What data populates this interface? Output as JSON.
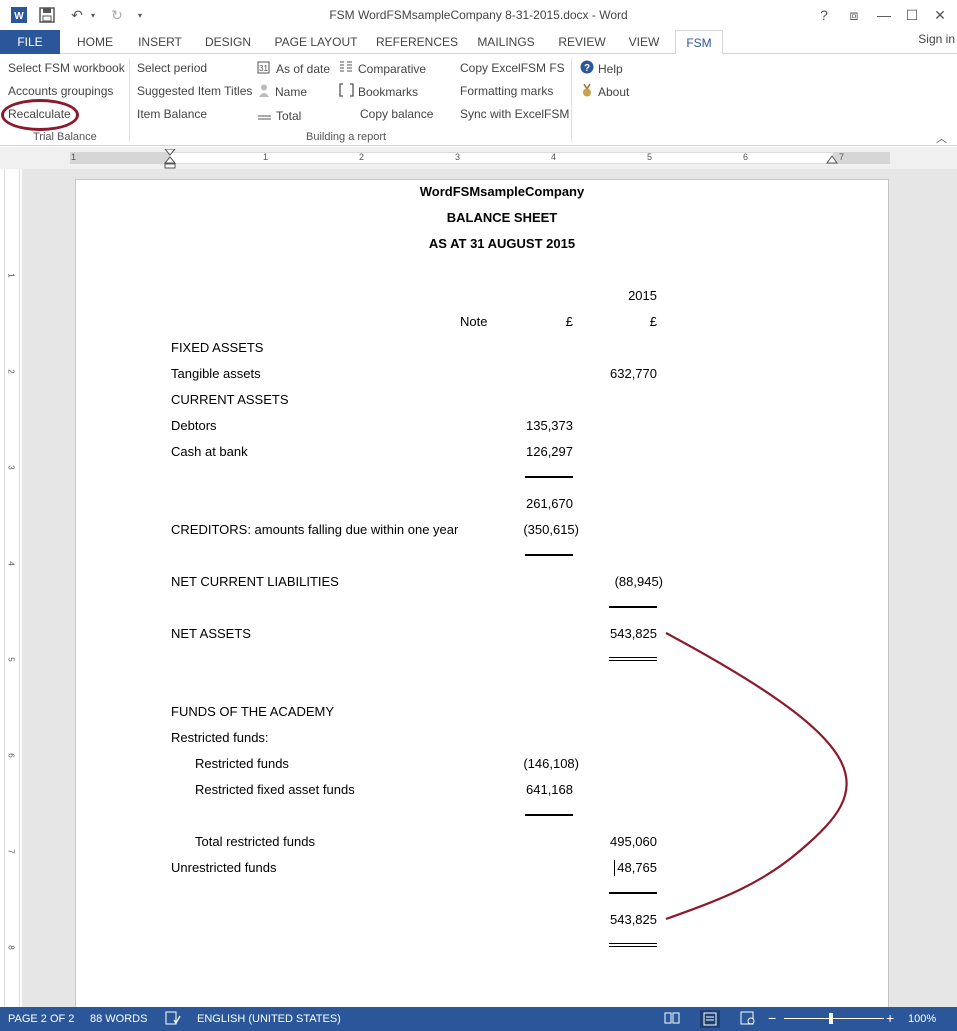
{
  "window": {
    "title": "FSM WordFSMsampleCompany 8-31-2015.docx - Word",
    "qat": {
      "word_icon": "word-app-icon",
      "save_icon": "save-icon",
      "undo_icon": "undo-icon",
      "redo_icon": "redo-icon",
      "customize_icon": "customize-qat-icon"
    },
    "controls": {
      "help": "?",
      "restore_ribbon": "⧈",
      "minimize": "—",
      "maximize": "☐",
      "close": "✕"
    }
  },
  "tabs": [
    {
      "label": "FILE"
    },
    {
      "label": "HOME"
    },
    {
      "label": "INSERT"
    },
    {
      "label": "DESIGN"
    },
    {
      "label": "PAGE LAYOUT"
    },
    {
      "label": "REFERENCES"
    },
    {
      "label": "MAILINGS"
    },
    {
      "label": "REVIEW"
    },
    {
      "label": "VIEW"
    },
    {
      "label": "FSM"
    }
  ],
  "active_tab": "FSM",
  "signin": "Sign in",
  "ribbon": {
    "trial_balance": {
      "label": "Trial Balance",
      "select_fsm_workbook": "Select FSM workbook",
      "accounts_groupings": "Accounts groupings",
      "recalculate": "Recalculate"
    },
    "building_report": {
      "label": "Building a report",
      "select_period": "Select period",
      "suggested_item_titles": "Suggested Item Titles",
      "item_balance": "Item Balance",
      "as_of_date": "As of date",
      "name": "Name",
      "total": "Total",
      "comparative": "Comparative",
      "bookmarks": "Bookmarks",
      "copy_balance": "Copy balance",
      "copy_excelfsm_fs": "Copy ExcelFSM FS",
      "formatting_marks": "Formatting marks",
      "sync_with_excelfsm": "Sync with ExcelFSM"
    },
    "help": {
      "help": "Help",
      "about": "About"
    }
  },
  "ruler": {
    "h_numbers": [
      "1",
      "1",
      "2",
      "3",
      "4",
      "5",
      "6",
      "7"
    ],
    "v_numbers": [
      "1",
      "2",
      "3",
      "4",
      "5",
      "6",
      "7",
      "8"
    ]
  },
  "document": {
    "company": "WordFSMsampleCompany",
    "heading": "BALANCE SHEET",
    "date_line": "AS AT 31 AUGUST 2015",
    "year": "2015",
    "note_header": "Note",
    "currency_col1": "£",
    "currency_col2": "£",
    "fixed_assets": "FIXED ASSETS",
    "tangible_assets": "Tangible assets",
    "tangible_assets_value": "632,770",
    "current_assets": "CURRENT ASSETS",
    "debtors": "Debtors",
    "debtors_value": "135,373",
    "cash_at_bank": "Cash at bank",
    "cash_at_bank_value": "126,297",
    "current_assets_total": "261,670",
    "creditors": "CREDITORS: amounts falling due within one year",
    "creditors_value": "(350,615)",
    "net_current_liabilities": "NET CURRENT LIABILITIES",
    "net_current_liabilities_value": "(88,945)",
    "net_assets": "NET ASSETS",
    "net_assets_value": "543,825",
    "funds_of_academy": "FUNDS OF THE ACADEMY",
    "restricted_funds_heading": "Restricted funds:",
    "restricted_funds": "Restricted funds",
    "restricted_funds_value": "(146,108)",
    "restricted_fixed_asset_funds": "Restricted fixed asset funds",
    "restricted_fixed_asset_funds_value": "641,168",
    "total_restricted_funds": "Total restricted funds",
    "total_restricted_funds_value": "495,060",
    "unrestricted_funds": "Unrestricted funds",
    "unrestricted_funds_value": "48,765",
    "total_funds_value": "543,825"
  },
  "statusbar": {
    "page": "PAGE 2 OF 2",
    "words": "88 WORDS",
    "language": "ENGLISH (UNITED STATES)",
    "zoom": "100%",
    "zoom_out": "−",
    "zoom_in": "+"
  },
  "colors": {
    "accent": "#2b579a",
    "annotation": "#8c1a2e"
  }
}
